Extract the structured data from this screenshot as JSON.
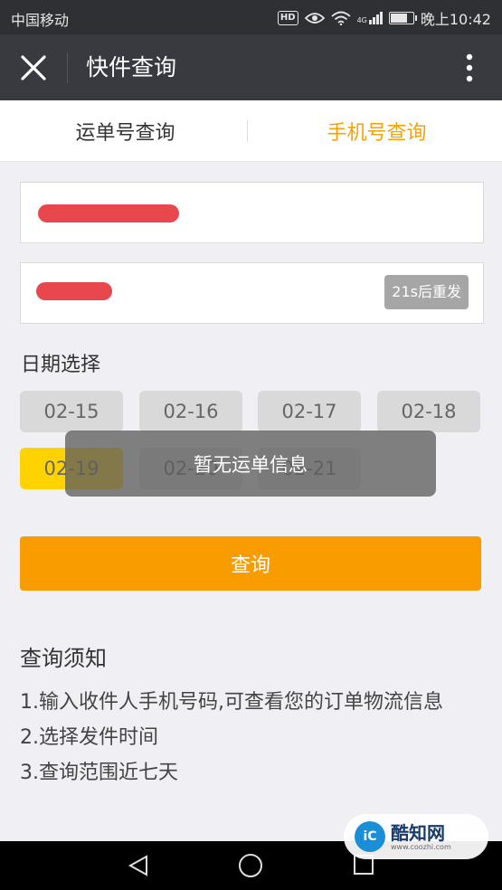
{
  "status_bar": {
    "carrier": "中国移动",
    "hd": "HD",
    "network": "4G",
    "time": "晚上10:42"
  },
  "nav": {
    "title": "快件查询"
  },
  "tabs": [
    {
      "label": "运单号查询",
      "active": false
    },
    {
      "label": "手机号查询",
      "active": true
    }
  ],
  "form": {
    "phone_value": "",
    "code_value": "",
    "resend_label": "21s后重发"
  },
  "date_section": {
    "label": "日期选择",
    "dates": [
      "02-15",
      "02-16",
      "02-17",
      "02-18",
      "02-19",
      "02-20",
      "02-21"
    ],
    "selected": "02-19"
  },
  "query_button": "查询",
  "notice": {
    "title": "查询须知",
    "items": [
      "1.输入收件人手机号码,可查看您的订单物流信息",
      "2.选择发件时间",
      "3.查询范围近七天"
    ]
  },
  "toast": "暂无运单信息",
  "watermark": {
    "logo": "iC",
    "name": "酷知网",
    "url": "www.coozhi.com"
  },
  "colors": {
    "accent": "#f99c00",
    "tab_active": "#f2a20a",
    "selected_date": "#ffd200",
    "redaction": "#e8474d"
  }
}
